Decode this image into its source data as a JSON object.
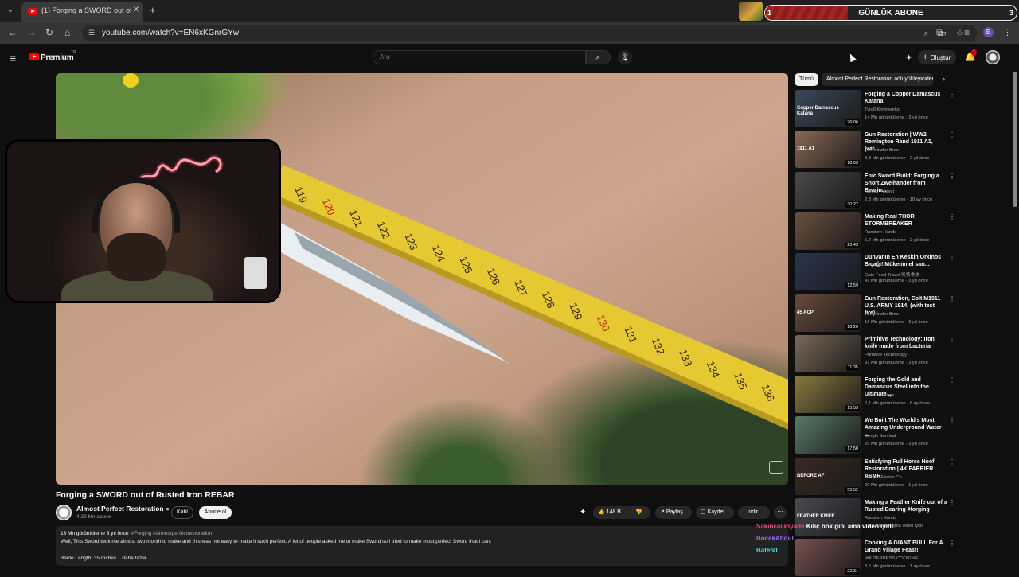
{
  "browser": {
    "tab_title": "(1) Forging a SWORD out of Ru",
    "url": "youtube.com/watch?v=EN6xKGnrGYw",
    "new_tab": "+",
    "tab_close": "✕"
  },
  "stream_overlay": {
    "goal_label": "GÜNLÜK ABONE",
    "goal_current": "1",
    "goal_target": "3",
    "goal_progress": 0.33
  },
  "yt": {
    "brand": "Premium",
    "region": "TR",
    "search_placeholder": "Ara",
    "create_label": "Oluştur",
    "notif_count": "1"
  },
  "video": {
    "title": "Forging a SWORD out of Rusted Iron REBAR",
    "channel": "Almost Perfect Restoration",
    "subs": "4,29 Mn abone",
    "join": "Katıl",
    "subscribe": "Abone ol",
    "likes": "148 B",
    "share": "Paylaş",
    "save": "Kaydet",
    "download": "İndir",
    "meta": "13 Mn görüntüleme  3 yıl önce",
    "tags": "#Forging #Almostperfectrestoration",
    "desc": "Well, This Sword took me almost two month to make and this was not easy to make it such perfect. A lot of people asked me to make Sword so i tried to make most perfect Sword that i can.",
    "blade": "Blade Length: 35 Inches  ...daha fazla",
    "tape_numbers": [
      "119",
      "120",
      "121",
      "122",
      "123",
      "124",
      "125",
      "126",
      "127",
      "128",
      "129",
      "130",
      "131",
      "132",
      "133",
      "134",
      "135",
      "136"
    ]
  },
  "chips": {
    "all": "Tümü",
    "uploader": "Almost Perfect Restoration adlı yükleyiciden"
  },
  "recommendations": [
    {
      "title": "Forging a Copper Damascus Katana",
      "channel": "Tyrell Knifeworks",
      "meta": "14 Mn görüntüleme · 3 yıl önce",
      "duration": "26:06",
      "thumb_text": "Copper Damascus Katana",
      "color": "#3b4a5a"
    },
    {
      "title": "Gun Restoration | WW2 Remington Rand 1911 A1, (wit...",
      "channel": "The Kinzler Bros",
      "meta": "3,8 Mn görüntüleme · 2 yıl önce",
      "duration": "18:03",
      "thumb_text": "1911 A1",
      "color": "#8a6a55"
    },
    {
      "title": "Epic Sword Build: Forging a Short Zweihander from Bearin...",
      "channel": "Knives Project",
      "meta": "2,3 Mn görüntüleme · 10 ay önce",
      "duration": "30:27",
      "thumb_text": "",
      "color": "#4a4a4a"
    },
    {
      "title": "Making Real THOR STORMBREAKER",
      "channel": "Random Hands",
      "meta": "5,7 Mn görüntüleme · 2 yıl önce",
      "duration": "23:43",
      "thumb_text": "",
      "color": "#6a5040"
    },
    {
      "title": "Dünyanın En Keskin Orkinos Bıçağı! Mükemmel sarı...",
      "channel": "Cate Food Travel 凯特食旅",
      "meta": "41 Mn görüntüleme · 3 yıl önce",
      "duration": "12:59",
      "thumb_text": "",
      "color": "#2c3450"
    },
    {
      "title": "Gun Restoration, Colt M1911 U.S. ARMY 1914, (with test fire).",
      "channel": "The Kinzler Bros",
      "meta": "16 Mn görüntüleme · 3 yıl önce",
      "duration": "18:20",
      "thumb_text": "45 ACP",
      "color": "#6a4a3a"
    },
    {
      "title": "Primitive Technology: Iron knife made from bacteria",
      "channel": "Primitive Technology",
      "meta": "91 Mn görüntüleme · 3 yıl önce",
      "duration": "11:35",
      "thumb_text": "",
      "color": "#7a6a5a"
    },
    {
      "title": "Forging the Gold and Damascus Steel into the Ultimate ...",
      "channel": "HammerForge",
      "meta": "2,1 Mn görüntüleme · 6 ay önce",
      "duration": "15:53",
      "thumb_text": "",
      "color": "#8a7a40"
    },
    {
      "title": "We Built The World's Most Amazing Underground Water ...",
      "channel": "Jungle Survival",
      "meta": "25 Mn görüntüleme · 3 yıl önce",
      "duration": "17:50",
      "thumb_text": "",
      "color": "#5a7a6a"
    },
    {
      "title": "Satisfying Full Horse Hoof Restoration | 4K FARRIER ASMR",
      "channel": "Maupin Farrier Co",
      "meta": "20 Mn görüntüleme · 1 yıl önce",
      "duration": "55:52",
      "thumb_text": "BEFORE   AF",
      "color": "#3a2a22"
    },
    {
      "title": "Making a Feather Knife out of a Rusted Bearing #forging",
      "channel": "Random Hands",
      "meta": "Kılıç bok gibi ama video iyidi.",
      "duration": "",
      "thumb_text": "FEATHER KNIFE",
      "color": "#4a4a50"
    },
    {
      "title": "Cooking A GIANT BULL For A Grand Village Feast!",
      "channel": "WILDERNESS COOKING",
      "meta": "3,6 Mn görüntüleme · 1 ay önce",
      "duration": "22:31",
      "thumb_text": "",
      "color": "#7a5050"
    }
  ],
  "chat": [
    {
      "user": "SakincaliPiyade",
      "msg": "Kılıç bok gibi ama video iyidi.",
      "color": "#e84a8a"
    },
    {
      "user": "BocekAbdul",
      "msg": "",
      "color": "#9a6ae8"
    },
    {
      "user": "BateN1",
      "msg": "",
      "color": "#4ad8e8"
    }
  ]
}
